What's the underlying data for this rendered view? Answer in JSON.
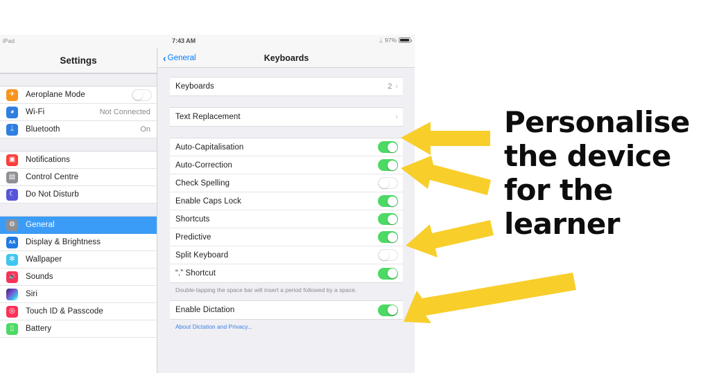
{
  "device": {
    "carrier_label": "iPad",
    "time": "7:43 AM",
    "battery_percent": "97%",
    "bluetooth_icon": "bluetooth-icon",
    "battery_icon": "battery-icon"
  },
  "sidebar": {
    "title": "Settings",
    "groups": [
      {
        "items": [
          {
            "label": "Aeroplane Mode",
            "icon": "airplane-icon",
            "icon_class": "ic-plane",
            "glyph": "✈",
            "control": "toggle",
            "toggle_on": false
          },
          {
            "label": "Wi-Fi",
            "icon": "wifi-icon",
            "icon_class": "ic-wifi",
            "glyph": "◠",
            "value": "Not Connected"
          },
          {
            "label": "Bluetooth",
            "icon": "bluetooth-icon",
            "icon_class": "ic-bt",
            "glyph": "ᛦ",
            "value": "On"
          }
        ]
      },
      {
        "items": [
          {
            "label": "Notifications",
            "icon": "notifications-icon",
            "icon_class": "ic-notif",
            "glyph": "▣"
          },
          {
            "label": "Control Centre",
            "icon": "control-centre-icon",
            "icon_class": "ic-cc",
            "glyph": "⚙"
          },
          {
            "label": "Do Not Disturb",
            "icon": "do-not-disturb-icon",
            "icon_class": "ic-dnd",
            "glyph": "☾"
          }
        ]
      },
      {
        "items": [
          {
            "label": "General",
            "icon": "general-gear-icon",
            "icon_class": "ic-gen",
            "glyph": "⚙",
            "selected": true
          },
          {
            "label": "Display & Brightness",
            "icon": "display-brightness-icon",
            "icon_class": "ic-disp",
            "glyph": "AA"
          },
          {
            "label": "Wallpaper",
            "icon": "wallpaper-icon",
            "icon_class": "ic-wall",
            "glyph": "✻"
          },
          {
            "label": "Sounds",
            "icon": "sounds-icon",
            "icon_class": "ic-sound",
            "glyph": "◂))"
          },
          {
            "label": "Siri",
            "icon": "siri-icon",
            "icon_class": "ic-siri",
            "glyph": ""
          },
          {
            "label": "Touch ID & Passcode",
            "icon": "touch-id-icon",
            "icon_class": "ic-touch",
            "glyph": "◎"
          },
          {
            "label": "Battery",
            "icon": "battery-settings-icon",
            "icon_class": "ic-batt",
            "glyph": "▭"
          }
        ]
      }
    ]
  },
  "detail": {
    "back_label": "General",
    "title": "Keyboards",
    "groups": [
      {
        "rows": [
          {
            "label": "Keyboards",
            "value": "2",
            "control": "disclosure"
          }
        ]
      },
      {
        "rows": [
          {
            "label": "Text Replacement",
            "value": "",
            "control": "disclosure"
          }
        ]
      },
      {
        "rows": [
          {
            "label": "Auto-Capitalisation",
            "control": "toggle",
            "toggle_on": true
          },
          {
            "label": "Auto-Correction",
            "control": "toggle",
            "toggle_on": true
          },
          {
            "label": "Check Spelling",
            "control": "toggle",
            "toggle_on": false
          },
          {
            "label": "Enable Caps Lock",
            "control": "toggle",
            "toggle_on": true
          },
          {
            "label": "Shortcuts",
            "control": "toggle",
            "toggle_on": true
          },
          {
            "label": "Predictive",
            "control": "toggle",
            "toggle_on": true
          },
          {
            "label": "Split Keyboard",
            "control": "toggle",
            "toggle_on": false
          },
          {
            "label": "“.” Shortcut",
            "control": "toggle",
            "toggle_on": true
          }
        ],
        "footnote": "Double-tapping the space bar will insert a period followed by a space."
      },
      {
        "rows": [
          {
            "label": "Enable Dictation",
            "control": "toggle",
            "toggle_on": true
          }
        ],
        "link": "About Dictation and Privacy..."
      }
    ]
  },
  "annotation": {
    "lines": [
      "Personalise",
      "the device",
      "for the",
      "learner"
    ],
    "arrow_color": "#F8CE2B",
    "arrow_count": 4
  }
}
